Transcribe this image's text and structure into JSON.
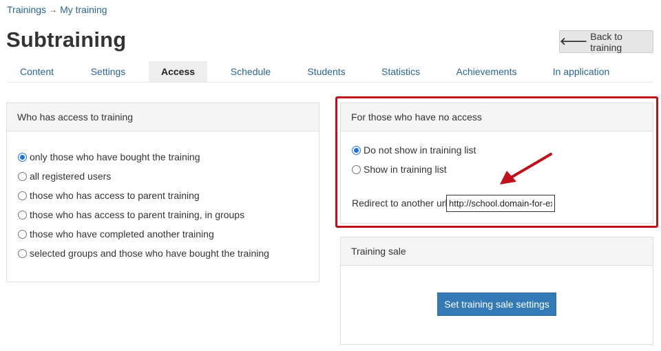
{
  "breadcrumb": {
    "items": [
      "Trainings",
      "My training"
    ],
    "separator": "→"
  },
  "page": {
    "title": "Subtraining"
  },
  "header": {
    "back_label": "Back to training",
    "back_icon": "arrow-left-icon"
  },
  "tabs": [
    {
      "label": "Content",
      "active": false
    },
    {
      "label": "Settings",
      "active": false
    },
    {
      "label": "Access",
      "active": true
    },
    {
      "label": "Schedule",
      "active": false
    },
    {
      "label": "Students",
      "active": false
    },
    {
      "label": "Statistics",
      "active": false
    },
    {
      "label": "Achievements",
      "active": false
    },
    {
      "label": "In application",
      "active": false
    }
  ],
  "access_panel": {
    "title": "Who has access to training",
    "options": [
      {
        "label": "only those who have bought the training",
        "checked": true
      },
      {
        "label": "all registered users",
        "checked": false
      },
      {
        "label": "those who has access to parent training",
        "checked": false
      },
      {
        "label": "those who has access to parent training, in groups",
        "checked": false
      },
      {
        "label": "those who have completed another training",
        "checked": false
      },
      {
        "label": "selected groups and those who have bought the training",
        "checked": false
      }
    ]
  },
  "no_access_panel": {
    "title": "For those who have no access",
    "options": [
      {
        "label": "Do not show in training list",
        "checked": true
      },
      {
        "label": "Show in training list",
        "checked": false
      }
    ],
    "redirect_label": "Redirect to another url",
    "redirect_value": "http://school.domain-for-example.com"
  },
  "sale_panel": {
    "title": "Training sale",
    "button_label": "Set training sale settings"
  },
  "colors": {
    "link": "#2a6496",
    "primary_button": "#337ab7",
    "highlight_border": "#c0101a",
    "annotation_arrow": "#c0101a"
  }
}
